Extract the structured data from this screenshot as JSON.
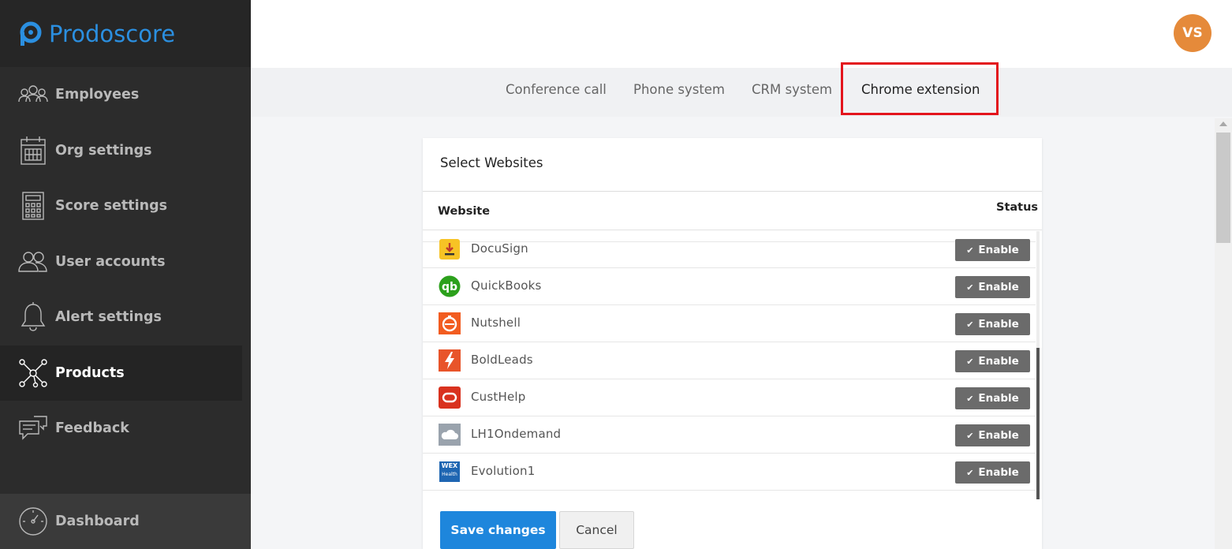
{
  "app": {
    "brand": "Prodoscore",
    "brand_color": "#2b8fe0"
  },
  "sidebar": {
    "items": [
      {
        "label": "Employees",
        "icon": "employees-icon"
      },
      {
        "label": "Org settings",
        "icon": "calendar-icon"
      },
      {
        "label": "Score settings",
        "icon": "calculator-icon"
      },
      {
        "label": "User accounts",
        "icon": "user-accounts-icon"
      },
      {
        "label": "Alert settings",
        "icon": "bell-icon"
      },
      {
        "label": "Products",
        "icon": "network-icon",
        "active": true
      },
      {
        "label": "Feedback",
        "icon": "feedback-icon"
      }
    ],
    "bottom": {
      "label": "Dashboard",
      "icon": "gauge-icon"
    }
  },
  "header": {
    "avatar_initials": "VS",
    "avatar_color": "#e58a3a"
  },
  "tabs": [
    {
      "label": "Conference call"
    },
    {
      "label": "Phone system"
    },
    {
      "label": "CRM system"
    },
    {
      "label": "Chrome extension",
      "active": true
    }
  ],
  "card": {
    "title": "Select Websites",
    "columns": {
      "website": "Website",
      "status": "Status"
    },
    "rows": [
      {
        "name": "DocuSign",
        "status": "Enable",
        "icon": "docusign-icon"
      },
      {
        "name": "QuickBooks",
        "status": "Enable",
        "icon": "quickbooks-icon"
      },
      {
        "name": "Nutshell",
        "status": "Enable",
        "icon": "nutshell-icon"
      },
      {
        "name": "BoldLeads",
        "status": "Enable",
        "icon": "boldleads-icon"
      },
      {
        "name": "CustHelp",
        "status": "Enable",
        "icon": "custhelp-icon"
      },
      {
        "name": "LH1Ondemand",
        "status": "Enable",
        "icon": "cloud-icon"
      },
      {
        "name": "Evolution1",
        "status": "Enable",
        "icon": "wex-health-icon",
        "icon_text": [
          "WEX",
          "Health"
        ]
      }
    ],
    "save_label": "Save changes",
    "cancel_label": "Cancel"
  },
  "colors": {
    "sidebar_bg": "#2c2c2c",
    "enable_button": "#6b6b6b",
    "save_button": "#1e86dc",
    "highlight_box": "#e3141c"
  }
}
